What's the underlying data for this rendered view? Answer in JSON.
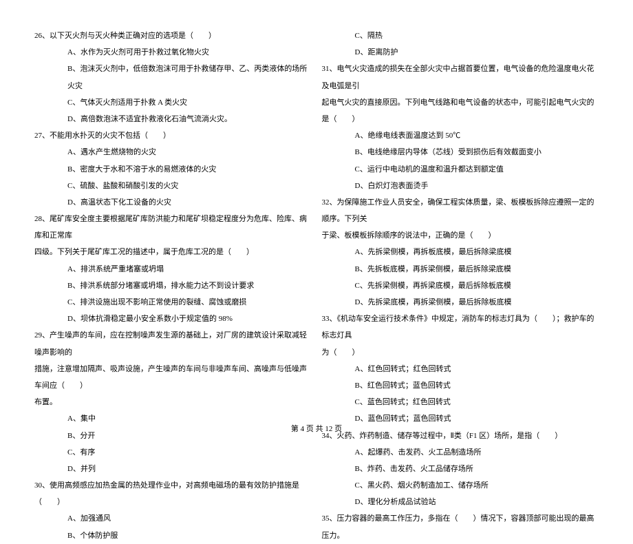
{
  "left_column": {
    "q26": {
      "text": "26、以下灭火剂与灭火种类正确对应的选项是（　　）",
      "opt_a": "A、水作为灭火剂可用于扑救过氧化物火灾",
      "opt_b": "B、泡沫灭火剂中，低倍数泡沫可用于扑救储存甲、乙、丙类液体的场所火灾",
      "opt_c": "C、气体灭火剂适用于扑救 A 类火灾",
      "opt_d": "D、高倍数泡沫不适宜扑救液化石油气流淌火灾。"
    },
    "q27": {
      "text": "27、不能用水扑灭的火灾不包括（　　）",
      "opt_a": "A、遇水产生燃烧物的火灾",
      "opt_b": "B、密度大于水和不溶于水的易燃液体的火灾",
      "opt_c": "C、硫酸、盐酸和硝酸引发的火灾",
      "opt_d": "D、高温状态下化工设备的火灾"
    },
    "q28": {
      "text": "28、尾矿库安全度主要根据尾矿库防洪能力和尾矿坝稳定程度分为危库、险库、病库和正常库",
      "text2": "四级。下列关于尾矿库工况的描述中，属于危库工况的是（　　）",
      "opt_a": "A、排洪系统严重堵塞或坍塌",
      "opt_b": "B、排洪系统部分堵塞或坍塌，排水能力达不到设计要求",
      "opt_c": "C、排洪设施出现不影响正常使用的裂缝、腐蚀或磨损",
      "opt_d": "D、坝体抗滑稳定最小安全系数小于规定值的 98%"
    },
    "q29": {
      "text": "29、产生噪声的车间，应在控制噪声发生源的基础上，对厂房的建筑设计采取减轻噪声影响的",
      "text2": "措施，注意增加隔声、吸声设施，产生噪声的车间与非噪声车间、高噪声与低噪声车间应（　　）",
      "text3": "布置。",
      "opt_a": "A、集中",
      "opt_b": "B、分开",
      "opt_c": "C、有序",
      "opt_d": "D、并列"
    },
    "q30": {
      "text": "30、使用高频感应加热金属的热处理作业中，对高频电磁场的最有效防护措施是（　　）",
      "opt_a": "A、加强通风",
      "opt_b": "B、个体防护服"
    }
  },
  "right_column": {
    "q30_cont": {
      "opt_c": "C、隔热",
      "opt_d": "D、距离防护"
    },
    "q31": {
      "text": "31、电气火灾造成的损失在全部火灾中占据首要位置，电气设备的危险温度电火花及电弧是引",
      "text2": "起电气火灾的直接原因。下列电气线路和电气设备的状态中，可能引起电气火灾的是（　　）",
      "opt_a": "A、绝缘电线表面温度达到 50℃",
      "opt_b": "B、电线绝缘层内导体（芯线）受到损伤后有效截面变小",
      "opt_c": "C、运行中电动机的温度和温升都达到额定值",
      "opt_d": "D、白炽灯泡表面烫手"
    },
    "q32": {
      "text": "32、为保障施工作业人员安全，确保工程实体质量，梁、板模板拆除应遵照一定的顺序。下列关",
      "text2": "于梁、板模板拆除顺序的说法中，正确的是（　　）",
      "opt_a": "A、先拆梁侧模，再拆板底模，最后拆除梁底模",
      "opt_b": "B、先拆板底模，再拆梁侧模，最后拆除梁底模",
      "opt_c": "C、先拆梁侧模，再拆梁底模，最后拆除板底模",
      "opt_d": "D、先拆梁底模，再拆梁侧模，最后拆除板底模"
    },
    "q33": {
      "text": "33、《机动车安全运行技术条件》中规定，消防车的标志灯具为（　　）；救护车的标志灯具",
      "text2": "为（　　）",
      "opt_a": "A、红色回转式；红色回转式",
      "opt_b": "B、红色回转式；蓝色回转式",
      "opt_c": "C、蓝色回转式；红色回转式",
      "opt_d": "D、蓝色回转式；蓝色回转式"
    },
    "q34": {
      "text": "34、火药、炸药制造、储存等过程中，Ⅱ类（F1 区）场所，是指（　　）",
      "opt_a": "A、起爆药、击发药、火工品制造场所",
      "opt_b": "B、炸药、击发药、火工品储存场所",
      "opt_c": "C、黑火药、烟火药制造加工、储存场所",
      "opt_d": "D、理化分析成品试验站"
    },
    "q35": {
      "text": "35、压力容器的最高工作压力，多指在（　　）情况下，容器顶部可能出现的最高压力。"
    }
  },
  "footer": "第 4 页 共 12 页"
}
